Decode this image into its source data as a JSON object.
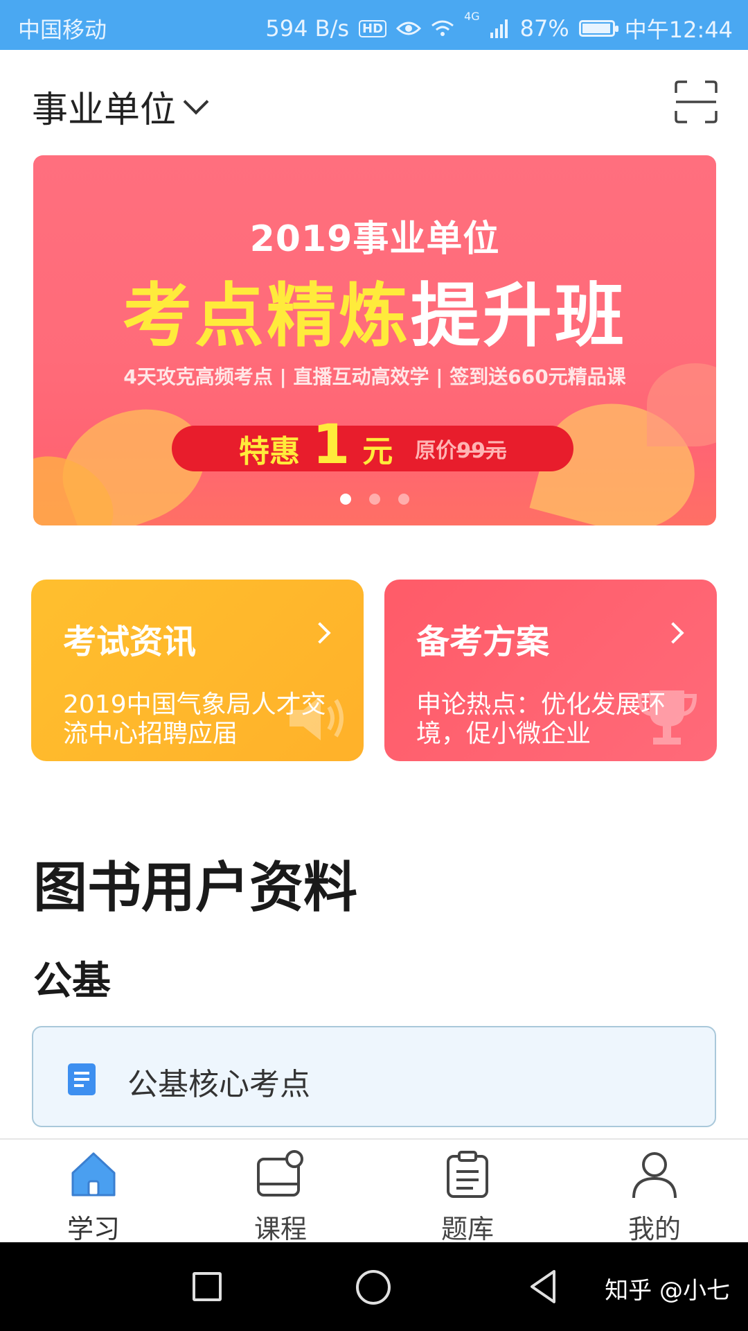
{
  "status_bar": {
    "carrier": "中国移动",
    "net_speed": "594 B/s",
    "hd": "HD",
    "network": "4G",
    "battery_pct": "87%",
    "battery_level": 0.87,
    "time": "中午12:44"
  },
  "header": {
    "title": "事业单位",
    "icons": [
      "chevron-down-icon",
      "scan-icon"
    ]
  },
  "banner": {
    "year_line": "2019事业单位",
    "main_part1": "考点精炼",
    "main_part2": "提升班",
    "subline": "4天攻克高频考点 | 直播互动高效学 | 签到送660元精品课",
    "price_prefix": "特惠",
    "price_value": "1",
    "price_unit": "元",
    "orig_label": "原价",
    "orig_price": "99元",
    "active_slide": 1,
    "slide_count": 3
  },
  "cards": [
    {
      "title": "考试资讯",
      "desc": "2019中国气象局人才交流中心招聘应届",
      "icon": "speaker-icon",
      "color": "#ffb82c"
    },
    {
      "title": "备考方案",
      "desc": "申论热点：优化发展环境，促小微企业",
      "icon": "trophy-icon",
      "color": "#ff5f6d"
    }
  ],
  "section": {
    "title": "图书用户资料",
    "subtitle": "公基",
    "items": [
      {
        "label": "公基核心考点",
        "icon": "document-icon"
      }
    ]
  },
  "tabbar": [
    {
      "label": "学习",
      "icon": "home-icon",
      "active": true
    },
    {
      "label": "课程",
      "icon": "course-icon",
      "active": false
    },
    {
      "label": "题库",
      "icon": "clipboard-icon",
      "active": false
    },
    {
      "label": "我的",
      "icon": "person-icon",
      "active": false
    }
  ],
  "system_nav": {
    "icons": [
      "recent-apps-icon",
      "home-circle-icon",
      "back-icon"
    ],
    "watermark": "知乎 @小七"
  },
  "colors": {
    "status_bar": "#4aa8f2",
    "accent_blue": "#4a9ff0",
    "banner_red": "#ff6b79",
    "card_yellow": "#ffb82c",
    "card_red": "#ff5f6d"
  }
}
